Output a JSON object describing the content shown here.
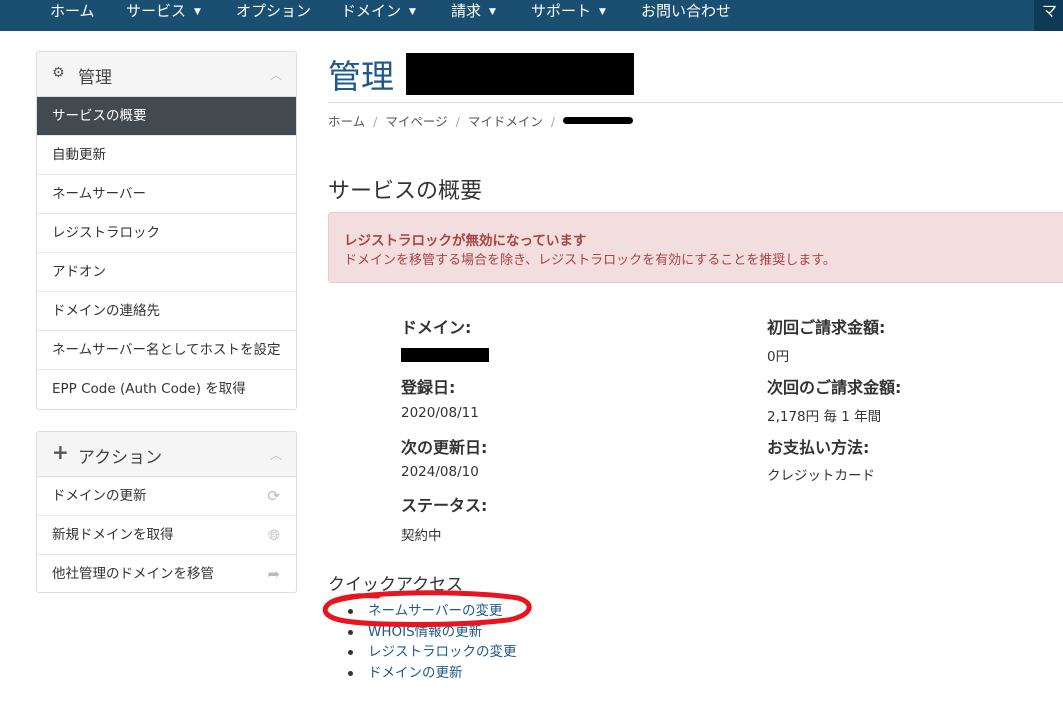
{
  "topnav": {
    "items": [
      {
        "label": "ホーム",
        "caret": false
      },
      {
        "label": "サービス",
        "caret": true
      },
      {
        "label": "オプション",
        "caret": false
      },
      {
        "label": "ドメイン",
        "caret": true
      },
      {
        "label": "請求",
        "caret": true
      },
      {
        "label": "サポート",
        "caret": true
      },
      {
        "label": "お問い合わせ",
        "caret": false
      }
    ],
    "right_label": "マ",
    "caret_symbol": "▼"
  },
  "sidebar": {
    "manage": {
      "title": "管理",
      "icon": "gear-icon",
      "items": [
        {
          "label": "サービスの概要",
          "active": true
        },
        {
          "label": "自動更新"
        },
        {
          "label": "ネームサーバー"
        },
        {
          "label": "レジストラロック"
        },
        {
          "label": "アドオン"
        },
        {
          "label": "ドメインの連絡先"
        },
        {
          "label": "ネームサーバー名としてホストを設定"
        },
        {
          "label": "EPP Code (Auth Code) を取得"
        }
      ]
    },
    "actions": {
      "title": "アクション",
      "icon": "plus-icon",
      "items": [
        {
          "label": "ドメインの更新",
          "icon": "refresh-icon"
        },
        {
          "label": "新規ドメインを取得",
          "icon": "globe-icon"
        },
        {
          "label": "他社管理のドメインを移管",
          "icon": "share-arrow-icon"
        }
      ]
    }
  },
  "main": {
    "title": "管理",
    "breadcrumb": [
      "ホーム",
      "マイページ",
      "マイドメイン"
    ],
    "section_title": "サービスの概要",
    "alert": {
      "title": "レジストラロックが無効になっています",
      "text": "ドメインを移管する場合を除き、レジストラロックを有効にすることを推奨します。"
    },
    "fields": {
      "domain_label": "ドメイン:",
      "registered_label": "登録日:",
      "registered_value": "2020/08/11",
      "next_renewal_label": "次の更新日:",
      "next_renewal_value": "2024/08/10",
      "status_label": "ステータス:",
      "status_value": "契約中",
      "first_payment_label": "初回ご請求金額:",
      "first_payment_value": "0円",
      "recurring_label": "次回のご請求金額:",
      "recurring_value": "2,178円 毎 1 年間",
      "payment_method_label": "お支払い方法:",
      "payment_method_value": "クレジットカード"
    },
    "quick_access": {
      "title": "クイックアクセス",
      "links": [
        "ネームサーバーの変更",
        "WHOIS情報の更新",
        "レジストラロックの変更",
        "ドメインの更新"
      ]
    }
  },
  "colors": {
    "nav_bg": "#1b4f72",
    "link": "#1e5a8a",
    "active_menu_bg": "#424a4f",
    "alert_bg": "#f2dede",
    "alert_text": "#a94442",
    "annotation": "#e8141e"
  }
}
